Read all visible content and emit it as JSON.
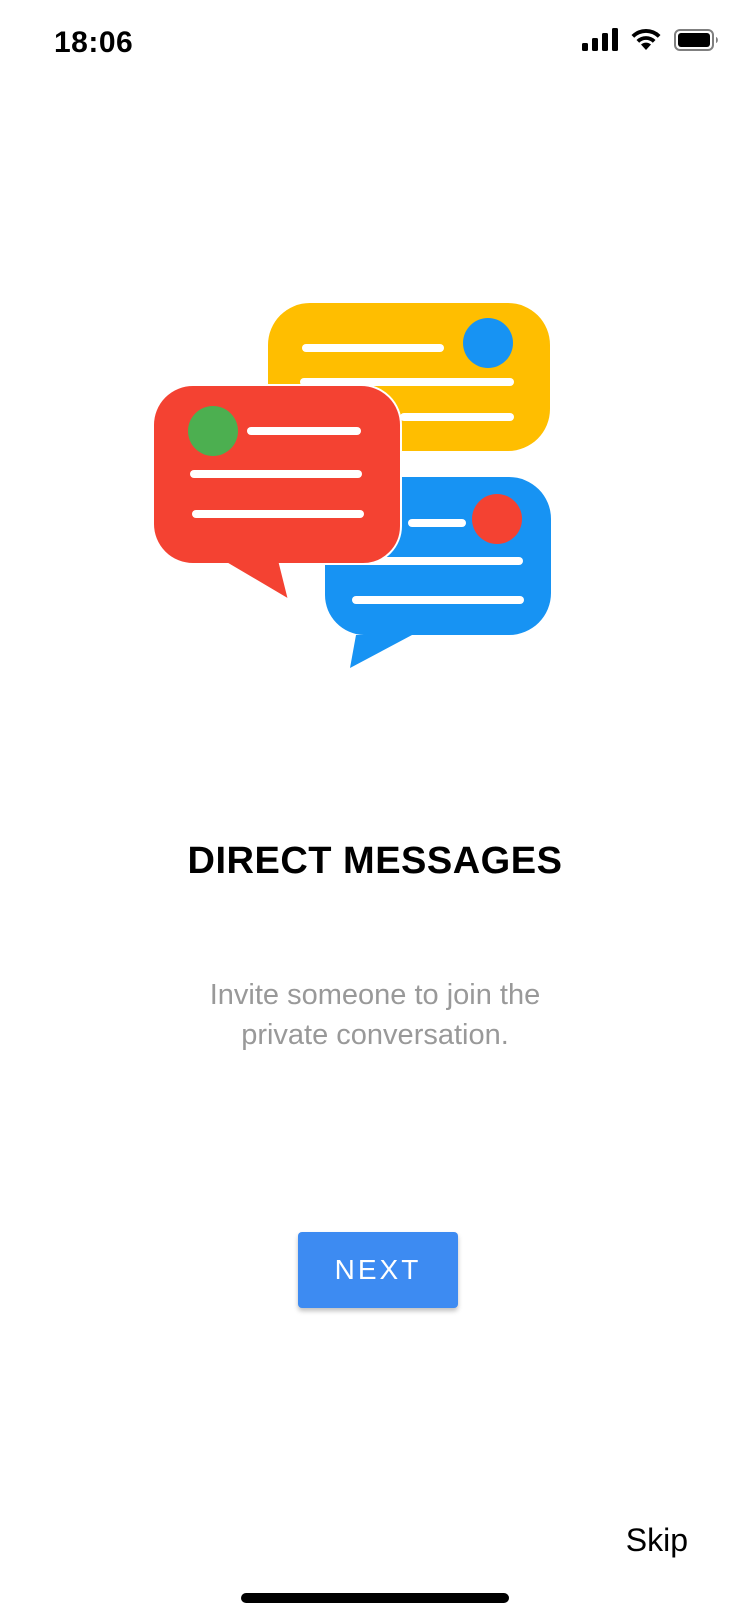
{
  "status_bar": {
    "time": "18:06",
    "icons": [
      "cellular-signal-icon",
      "wifi-icon",
      "battery-icon"
    ]
  },
  "illustration": {
    "icon": "chat-bubbles-icon",
    "colors": {
      "yellow_bubble": "#ffbe00",
      "red_bubble": "#f44232",
      "blue_bubble": "#1793f3",
      "green_dot": "#4caf50"
    }
  },
  "onboarding": {
    "title": "DIRECT MESSAGES",
    "subtitle": "Invite someone to join the\nprivate conversation."
  },
  "actions": {
    "next_label": "NEXT",
    "skip_label": "Skip",
    "accent_color": "#3d8bf2"
  }
}
